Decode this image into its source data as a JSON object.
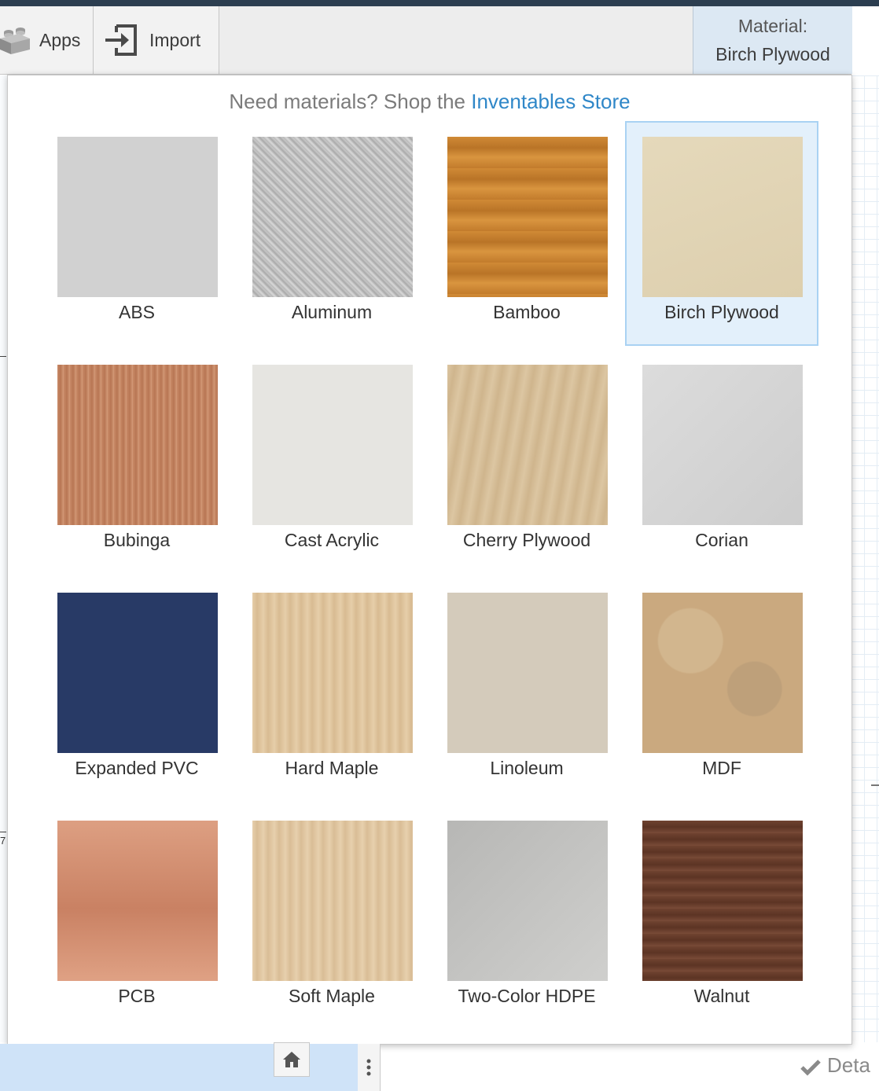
{
  "toolbar": {
    "apps_label": "Apps",
    "import_label": "Import",
    "material_caption": "Material:",
    "material_value": "Birch Plywood"
  },
  "popup": {
    "promo_text": "Need materials? Shop the ",
    "promo_link": "Inventables Store",
    "selected": "Birch Plywood",
    "materials": [
      {
        "label": "ABS",
        "color": "#d1d1d1"
      },
      {
        "label": "Aluminum",
        "color": "#bdbdbd"
      },
      {
        "label": "Bamboo",
        "color": "#c9822e"
      },
      {
        "label": "Birch Plywood",
        "color": "#e2d5b6"
      },
      {
        "label": "Bubinga",
        "color": "#c88a68"
      },
      {
        "label": "Cast Acrylic",
        "color": "#e6e5e1"
      },
      {
        "label": "Cherry Plywood",
        "color": "#d7c09b"
      },
      {
        "label": "Corian",
        "color": "#d6d6d6"
      },
      {
        "label": "Expanded PVC",
        "color": "#283a66"
      },
      {
        "label": "Hard Maple",
        "color": "#e3c9a4"
      },
      {
        "label": "Linoleum",
        "color": "#d4cbbb"
      },
      {
        "label": "MDF",
        "color": "#c9a97e"
      },
      {
        "label": "PCB",
        "color": "#da9a7c"
      },
      {
        "label": "Soft Maple",
        "color": "#e4ccaa"
      },
      {
        "label": "Two-Color HDPE",
        "color": "#bdbdbb"
      },
      {
        "label": "Walnut",
        "color": "#6e4330"
      }
    ]
  },
  "canvas": {
    "axis_number": "7",
    "details_label": "Deta"
  },
  "icons": {
    "apps": "lego-brick-icon",
    "import": "import-icon",
    "home": "home-icon",
    "more": "vertical-dots-icon",
    "check": "checkmark-icon"
  }
}
